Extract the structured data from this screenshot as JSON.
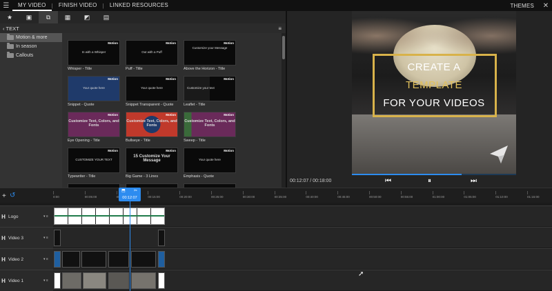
{
  "topbar": {
    "tabs": [
      {
        "label": "MY VIDEO"
      },
      {
        "label": "FINISH VIDEO"
      },
      {
        "label": "LINKED RESOURCES"
      }
    ],
    "right_label": "THEMES"
  },
  "panel": {
    "section_title": "TEXT",
    "categories": [
      {
        "label": "Motion & more"
      },
      {
        "label": "In season"
      },
      {
        "label": "Callouts"
      }
    ],
    "templates": [
      {
        "caption": "Whisper - Title",
        "badge": "Motion",
        "inner": "In with a Whisper"
      },
      {
        "caption": "Puff - Title",
        "badge": "Motion",
        "inner": "Out with a Puff"
      },
      {
        "caption": "Above the Horizon - Title",
        "badge": "Motion",
        "inner": "Customize your Message"
      },
      {
        "caption": "Snippet - Quote",
        "badge": "Motion",
        "inner": "Your quote here"
      },
      {
        "caption": "Snippet Transparent - Quote",
        "badge": "Motion",
        "inner": "Your quote here"
      },
      {
        "caption": "Leaflet - Title",
        "badge": "Motion",
        "inner": "Customize your text"
      },
      {
        "caption": "Eye Opening - Title",
        "badge": "Motion",
        "inner": "Customize Text, Colors, and Fonts"
      },
      {
        "caption": "Bullseye - Title",
        "badge": "Motion",
        "inner": "Customize Text, Colors, and Fonts"
      },
      {
        "caption": "Sweep - Title",
        "badge": "Motion",
        "inner": "Customize Text, Colors, and Fonts"
      },
      {
        "caption": "Typewriter - Title",
        "badge": "Motion",
        "inner": "CUSTOMIZE YOUR TEXT"
      },
      {
        "caption": "Big Game - 3 Lines",
        "badge": "Motion",
        "inner": "15 Customize Your Message"
      },
      {
        "caption": "Emphasis - Quote",
        "badge": "Motion",
        "inner": "Your quote here"
      }
    ]
  },
  "preview": {
    "line1": "CREATE A",
    "line2": "TEMPLATE",
    "line3": "FOR YOUR VIDEOS",
    "current_time": "00:12:07",
    "total_time": "00:18:00",
    "progress": 0.67,
    "accent": "#2d8cf0",
    "gold": "#e2c15c"
  },
  "timeline": {
    "playhead_time": "00:12:07",
    "ticks": [
      "0:00",
      "00:05:00",
      "00:10:00",
      "00:15:00",
      "00:20:00",
      "00:25:00",
      "00:30:00",
      "00:35:00",
      "00:40:00",
      "00:45:00",
      "00:50:00",
      "00:55:00",
      "01:00:00",
      "01:05:00",
      "01:10:00",
      "01:15:00"
    ],
    "tracks": [
      {
        "name": "Logo"
      },
      {
        "name": "Video 3"
      },
      {
        "name": "Video 2"
      },
      {
        "name": "Video 1"
      }
    ]
  }
}
